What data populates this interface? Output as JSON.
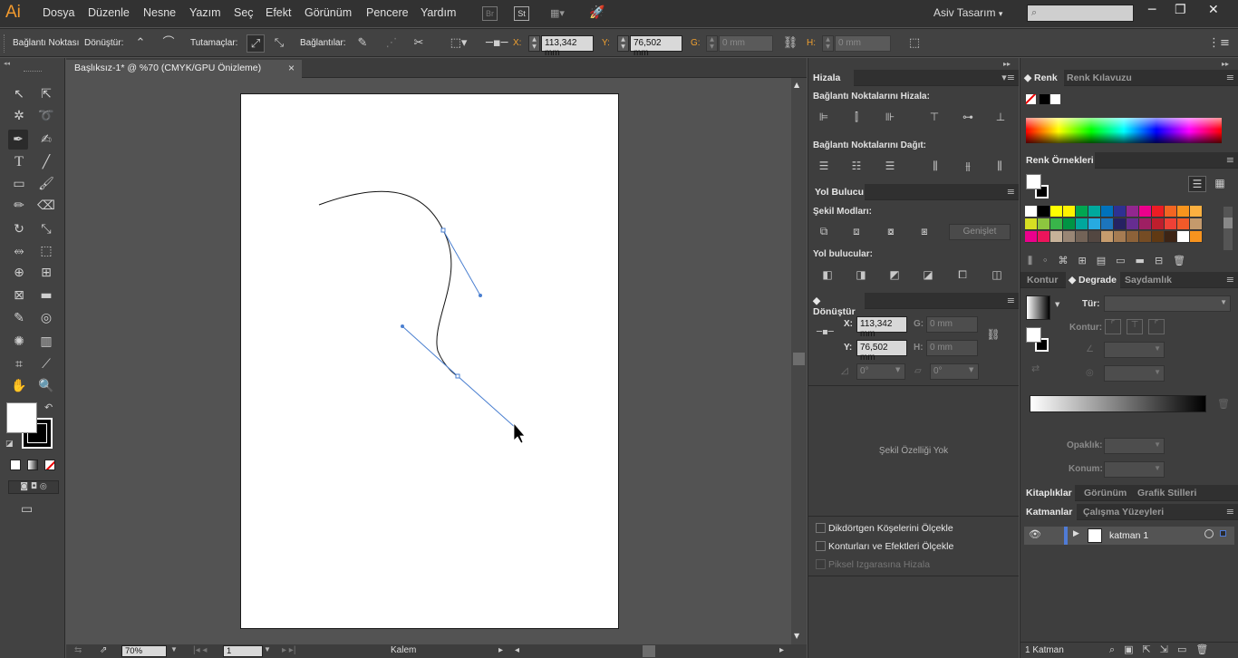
{
  "app": {
    "logo": "Ai",
    "workspace": "Asiv Tasarım"
  },
  "menu": [
    "Dosya",
    "Düzenle",
    "Nesne",
    "Yazım",
    "Seç",
    "Efekt",
    "Görünüm",
    "Pencere",
    "Yardım"
  ],
  "menubar_boxes": [
    "Br",
    "St"
  ],
  "window_controls": {
    "minimize": "─",
    "restore": "❐",
    "close": "✕"
  },
  "control": {
    "anchor_label": "Bağlantı Noktası",
    "convert_label": "Dönüştür:",
    "handles_label": "Tutamaçlar:",
    "anchors_label": "Bağlantılar:",
    "x_label": "X:",
    "x_value": "113,342 mm",
    "y_label": "Y:",
    "y_value": "76,502 mm",
    "w_label": "G:",
    "w_value": "0 mm",
    "h_label": "H:",
    "h_value": "0 mm"
  },
  "document": {
    "tab_title": "Başlıksız-1* @ %70 (CMYK/GPU Önizleme)",
    "close": "×"
  },
  "status": {
    "zoom": "70%",
    "artboard": "1",
    "tool": "Kalem"
  },
  "align": {
    "title": "Hizala",
    "align_objects": "Bağlantı Noktalarını Hizala:",
    "distribute_objects": "Bağlantı Noktalarını Dağıt:"
  },
  "pathfinder": {
    "title": "Yol Bulucu",
    "shape_modes": "Şekil Modları:",
    "expand": "Genişlet",
    "pathfinders": "Yol bulucular:"
  },
  "transform": {
    "title": "Dönüştür",
    "x_label": "X:",
    "x_value": "113,342 mm",
    "y_label": "Y:",
    "y_value": "76,502 mm",
    "w_label": "G:",
    "w_value": "0 mm",
    "h_label": "H:",
    "h_value": "0 mm",
    "rotate_value": "0°",
    "shear_value": "0°",
    "no_shape": "Şekil Özelliği Yok",
    "opt1": "Dikdörtgen Köşelerini Ölçekle",
    "opt2": "Konturları ve Efektleri Ölçekle",
    "opt3": "Piksel Izgarasına Hizala"
  },
  "color": {
    "tab1": "Renk",
    "tab2": "Renk Kılavuzu"
  },
  "swatches": {
    "title": "Renk Örnekleri",
    "colors": [
      "#ffffff",
      "#000000",
      "#ffff00",
      "#fff200",
      "#00a651",
      "#00a99d",
      "#0072bc",
      "#2e3192",
      "#92278f",
      "#ec008c",
      "#ed1c24",
      "#f26522",
      "#f7941d",
      "#fbb040",
      "#d7df23",
      "#8dc63f",
      "#39b54a",
      "#009444",
      "#00a79d",
      "#27aae1",
      "#1c75bc",
      "#262262",
      "#662d91",
      "#9e1f63",
      "#be1e2d",
      "#ef4136",
      "#f15a29",
      "#c49a6c",
      "#ec008c",
      "#ed145b",
      "#c7b299",
      "#998675",
      "#736357",
      "#534741",
      "#c69c6d",
      "#a67c52",
      "#8c6239",
      "#754c24",
      "#603913",
      "#3c2415",
      "#ffffff",
      "#f7931e"
    ]
  },
  "gradient": {
    "tab1": "Kontur",
    "tab2": "Degrade",
    "tab3": "Saydamlık",
    "type_label": "Tür:",
    "stroke_label": "Kontur:",
    "opacity_label": "Opaklık:",
    "location_label": "Konum:"
  },
  "libraries": {
    "tab1": "Kitaplıklar",
    "tab2": "Görünüm",
    "tab3": "Grafik Stilleri"
  },
  "layers": {
    "tab1": "Katmanlar",
    "tab2": "Çalışma Yüzeyleri",
    "layer_name": "katman 1",
    "count": "1 Katman"
  }
}
